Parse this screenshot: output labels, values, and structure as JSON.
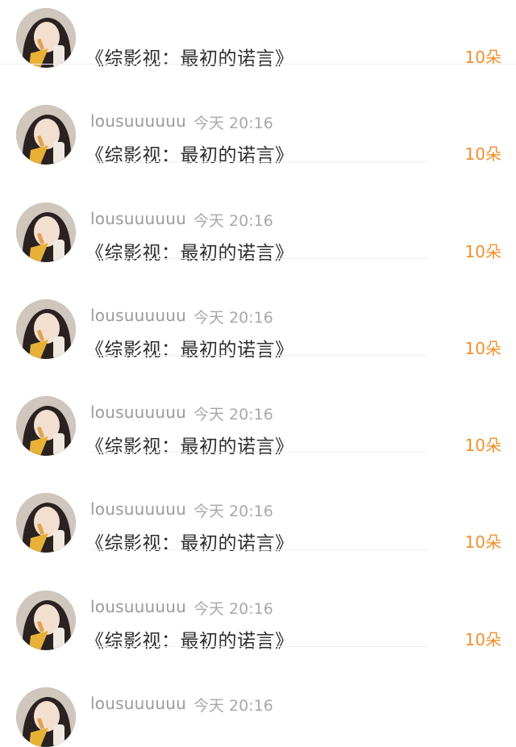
{
  "items": [
    {
      "username": "",
      "time": "",
      "gift": "《综影视：最初的诺言》",
      "count": "10朵"
    },
    {
      "username": "lousuuuuuu",
      "time": "今天 20:16",
      "gift": "《综影视：最初的诺言》",
      "count": "10朵"
    },
    {
      "username": "lousuuuuuu",
      "time": "今天 20:16",
      "gift": "《综影视：最初的诺言》",
      "count": "10朵"
    },
    {
      "username": "lousuuuuuu",
      "time": "今天 20:16",
      "gift": "《综影视：最初的诺言》",
      "count": "10朵"
    },
    {
      "username": "lousuuuuuu",
      "time": "今天 20:16",
      "gift": "《综影视：最初的诺言》",
      "count": "10朵"
    },
    {
      "username": "lousuuuuuu",
      "time": "今天 20:16",
      "gift": "《综影视：最初的诺言》",
      "count": "10朵"
    },
    {
      "username": "lousuuuuuu",
      "time": "今天 20:16",
      "gift": "《综影视：最初的诺言》",
      "count": "10朵"
    },
    {
      "username": "lousuuuuuu",
      "time": "今天 20:16",
      "gift": "",
      "count": ""
    }
  ],
  "colors": {
    "count": "#f0902a",
    "username": "#9a9a9a",
    "gift": "#2c2c2c"
  },
  "icons": {
    "avatar": "user-avatar-photo"
  }
}
